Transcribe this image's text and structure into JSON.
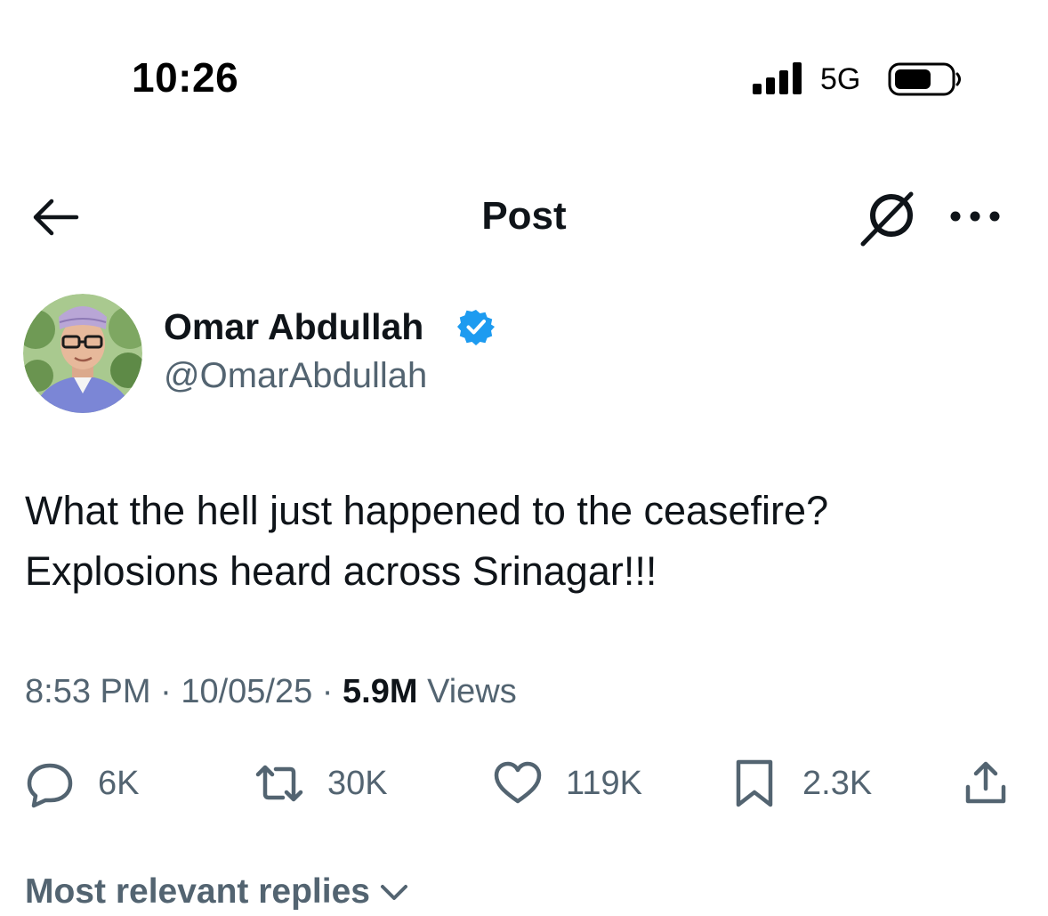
{
  "status_bar": {
    "time": "10:26",
    "network": "5G"
  },
  "header": {
    "title": "Post"
  },
  "author": {
    "name": "Omar Abdullah",
    "handle": "@OmarAbdullah",
    "verified": true
  },
  "tweet": {
    "lines": [
      "What the hell just happened to the ceasefire?",
      "Explosions heard across Srinagar!!!"
    ],
    "time": "8:53 PM",
    "date": "10/05/25",
    "views_count": "5.9M",
    "views_label": "Views",
    "separator": "·"
  },
  "actions": {
    "replies": "6K",
    "reposts": "30K",
    "likes": "119K",
    "bookmarks": "2.3K"
  },
  "replies_sort": {
    "label": "Most relevant replies"
  },
  "colors": {
    "text_primary": "#0f1419",
    "text_secondary": "#536471",
    "verified_blue": "#1d9bf0",
    "background": "#ffffff"
  },
  "icons": {
    "back": "arrow-left-icon",
    "grok": "grok-icon",
    "more": "more-horizontal-icon",
    "verified": "verified-badge-icon",
    "reply": "reply-icon",
    "repost": "repost-icon",
    "like": "heart-icon",
    "bookmark": "bookmark-icon",
    "share": "share-icon",
    "chevron": "chevron-down-icon"
  }
}
